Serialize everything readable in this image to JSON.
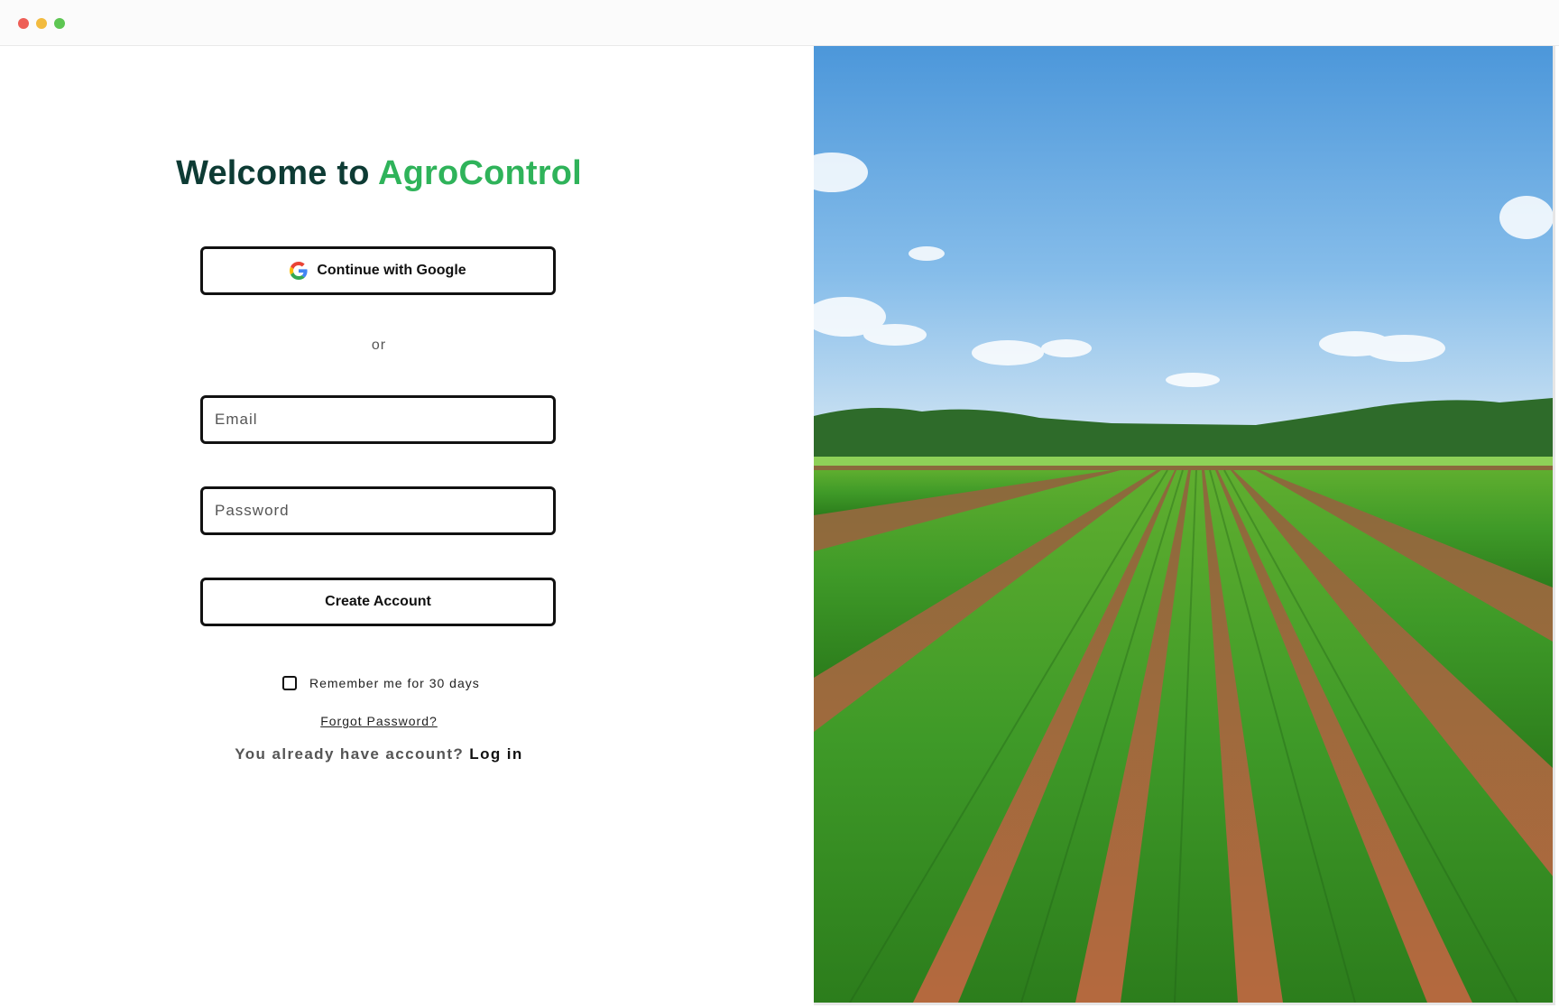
{
  "window": {
    "controls": [
      "close",
      "minimize",
      "maximize"
    ],
    "colors": {
      "close": "#ee5f57",
      "minimize": "#f2bb3f",
      "maximize": "#5dc652"
    }
  },
  "heading": {
    "prefix": "Welcome to",
    "brand": "AgroControl",
    "colors": {
      "text": "#0d3b34",
      "brand": "#2fb35a"
    }
  },
  "google_button": {
    "label": "Continue with Google",
    "icon": "google-icon"
  },
  "divider": {
    "text": "or"
  },
  "email": {
    "placeholder": "Email",
    "value": ""
  },
  "password": {
    "placeholder": "Password",
    "value": ""
  },
  "create_button": {
    "label": "Create Account"
  },
  "remember": {
    "label": "Remember me for 30 days",
    "checked": false
  },
  "forgot": {
    "label": "Forgot Password?"
  },
  "login_prompt": {
    "text": "You already have account?",
    "link": "Log in"
  },
  "hero_image": {
    "subject": "farm-field-photo"
  }
}
